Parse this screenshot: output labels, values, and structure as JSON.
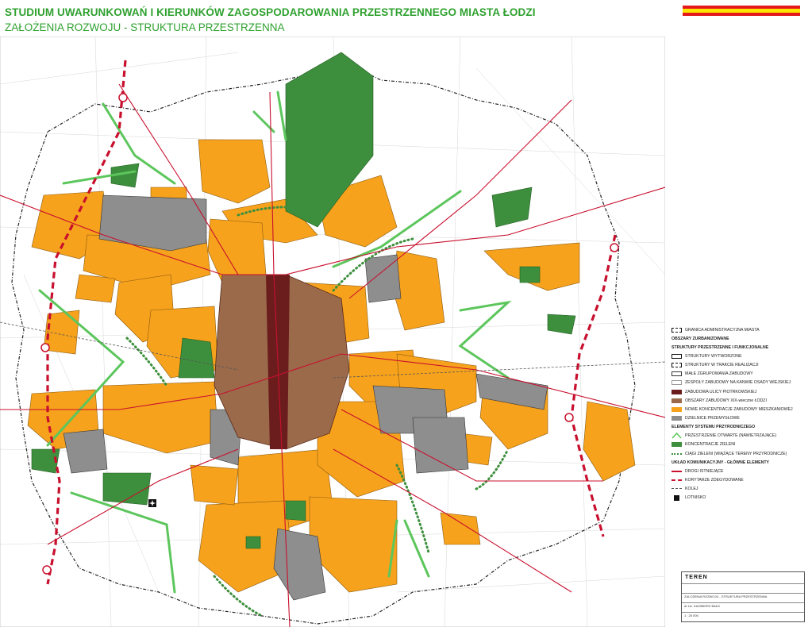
{
  "header": {
    "title": "STUDIUM UWARUNKOWAŃ I KIERUNKÓW ZAGOSPODAROWANIA PRZESTRZENNEGO MIASTA ŁODZI",
    "subtitle": "ZAŁOŻENIA ROZWOJU - STRUKTURA PRZESTRZENNA"
  },
  "colors": {
    "title_green": "#2fa12f",
    "flag_red": "#e3191c",
    "flag_yellow": "#ffe600",
    "residential_orange": "#f7a21c",
    "green_areas": "#3d8f3d",
    "industrial_gray": "#8e8e8e",
    "historic_brown": "#9a6a4a",
    "roads_red": "#c8102e"
  },
  "legend": {
    "admin_boundary": "GRANICA ADMINISTRACYJNA MIASTA",
    "urbanized_header": "OBSZARY ZURBANIZOWANE",
    "structures_header": "STRUKTURY PRZESTRZENNE I FUNKCJONALNE",
    "items_structures": [
      "STRUKTURY WYTWORZONE",
      "STRUKTURY W TRAKCIE REALIZACJI",
      "MAŁE ZGRUPOWANIA ZABUDOWY",
      "ZESPOŁY ZABUDOWY NA KANWIE OSADY WIEJSKIEJ",
      "ZABUDOWA ULICY PIOTRKOWSKIEJ",
      "OBSZARY ZABUDOWY XIX-wieczne ŁODZI",
      "NOWE KONCENTRACJE ZABUDOWY MIESZKANIOWEJ",
      "DZIELNICE PRZEMYSŁOWE"
    ],
    "nature_header": "ELEMENTY SYSTEMU PRZYRODNICZEGO",
    "items_nature": [
      "PRZESTRZENIE OTWARTE (NAWIETRZAJĄCE)",
      "KONCENTRACJE ZIELENI",
      "CIĄGI ZIELENI (WIĄŻĄCE TERENY PRZYRODNICZE)"
    ],
    "transport_header": "UKŁAD KOMUNIKACYJNY - GŁÓWNE ELEMENTY",
    "items_transport": [
      "DROGI ISTNIEJĄCE",
      "KORYTARZE ZDEGYDOWANE",
      "KOLEJ",
      "LOTNISKO"
    ]
  },
  "titleblock": {
    "logo": "TEREN",
    "rows": [
      "ZALOŻENIA ROZWOJU - STRUKTURA PRZESTRZENNA",
      "dr inż. KAZIMIERZ BAŁD",
      "1 : 25 000"
    ]
  }
}
